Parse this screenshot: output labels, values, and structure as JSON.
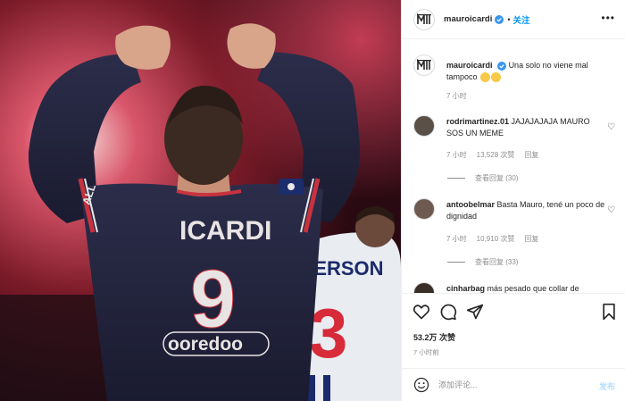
{
  "post": {
    "photo_alt": "Player wearing ICARDI 9 jersey raising fists",
    "jersey": {
      "name": "ICARDI",
      "number": "9",
      "sponsor": "ooredoo",
      "sleeve": "ALL"
    },
    "background_jersey": {
      "name": "MERSON",
      "number": "3"
    }
  },
  "header": {
    "username": "mauroicardi",
    "separator": "•",
    "follow_label": "关注",
    "more_icon": "more-icon"
  },
  "caption": {
    "username": "mauroicardi",
    "text": "Una solo no viene mal tampoco",
    "emoji_names": [
      "grin-sweat-emoji",
      "tongue-wink-emoji"
    ],
    "time": "7 小时"
  },
  "comments": [
    {
      "username": "rodrimartinez.01",
      "text": "JAJAJAJAJA MAURO SOS UN MEME",
      "time": "7 小时",
      "likes": "13,528 次赞",
      "reply_label": "回复",
      "view_replies": "查看回复 (30)"
    },
    {
      "username": "antoobelmar",
      "text": "Basta Mauro, tené un poco de dignidad",
      "time": "7 小时",
      "likes": "10,910 次赞",
      "reply_label": "回复",
      "view_replies": "查看回复 (33)"
    },
    {
      "username": "cinharbag",
      "text": "más pesado que collar de"
    }
  ],
  "footer": {
    "likes": "53.2万 次赞",
    "time": "7 小时前",
    "comment_placeholder": "添加评论...",
    "post_label": "发布"
  },
  "colors": {
    "accent": "#0095f6",
    "verified": "#3897f0",
    "post_disabled": "#b2dffc",
    "meta": "#8e8e8e"
  }
}
